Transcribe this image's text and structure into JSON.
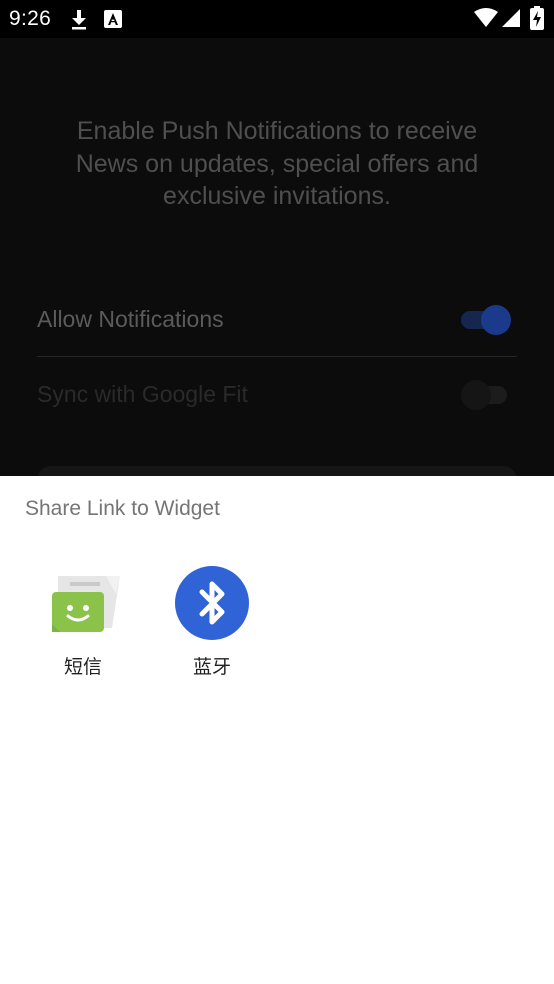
{
  "status_bar": {
    "time": "9:26",
    "icons": [
      "download-icon",
      "a-notification-icon",
      "wifi-icon",
      "signal-icon",
      "battery-charging-icon"
    ]
  },
  "background_app": {
    "promo_text": "Enable Push Notifications to receive News on updates, special offers and exclusive invitations.",
    "settings": [
      {
        "label": "Allow Notifications",
        "enabled": true
      },
      {
        "label": "Sync with Google Fit",
        "enabled": false
      }
    ]
  },
  "share_sheet": {
    "title": "Share Link to Widget",
    "targets": [
      {
        "label": "短信",
        "icon": "messaging-app-icon"
      },
      {
        "label": "蓝牙",
        "icon": "bluetooth-icon"
      }
    ]
  },
  "colors": {
    "toggle_on": "#1c3a8c",
    "bluetooth_blue": "#2f63d6",
    "messaging_green": "#8bc34a",
    "sheet_background": "#ffffff"
  }
}
